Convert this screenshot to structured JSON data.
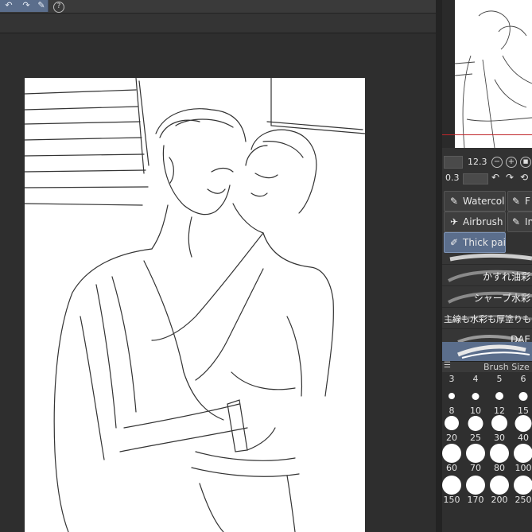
{
  "toolbar": {
    "buttons": [
      "↶",
      "↷",
      "✎"
    ],
    "help_glyph": "?"
  },
  "nav": {
    "zoom_value": "12.3",
    "angle_value": "0.3",
    "zoom_out_glyph": "−",
    "zoom_in_glyph": "+",
    "fit_glyph": "■",
    "rotate_left_glyph": "↶",
    "rotate_right_glyph": "↷",
    "reset_glyph": "⟲"
  },
  "brush_groups": [
    {
      "label": "Watercolor",
      "active": false
    },
    {
      "label": "F",
      "active": false
    },
    {
      "label": "Airbrush",
      "active": false
    },
    {
      "label": "In",
      "active": false
    },
    {
      "label": "Thick paint",
      "active": true
    }
  ],
  "brush_list": [
    {
      "label": "",
      "selected": false
    },
    {
      "label": "かすれ油彩",
      "selected": false
    },
    {
      "label": "シャープ水彩",
      "selected": false
    },
    {
      "label": "主線も水彩も厚塗りも",
      "selected": false
    },
    {
      "label": "DAE",
      "selected": false
    },
    {
      "label": "",
      "selected": true
    }
  ],
  "brush_size": {
    "title": "Brush Size",
    "sizes": [
      "3",
      "4",
      "5",
      "6",
      "8",
      "10",
      "12",
      "15",
      "20",
      "25",
      "30",
      "40",
      "60",
      "70",
      "80",
      "100",
      "150",
      "170",
      "200",
      "250"
    ]
  },
  "colors": {
    "accent": "#5b6e8c",
    "panel": "#323232",
    "canvas_bg": "#2e2e2e",
    "paper": "#ffffff",
    "nav_line": "#c0262a"
  }
}
